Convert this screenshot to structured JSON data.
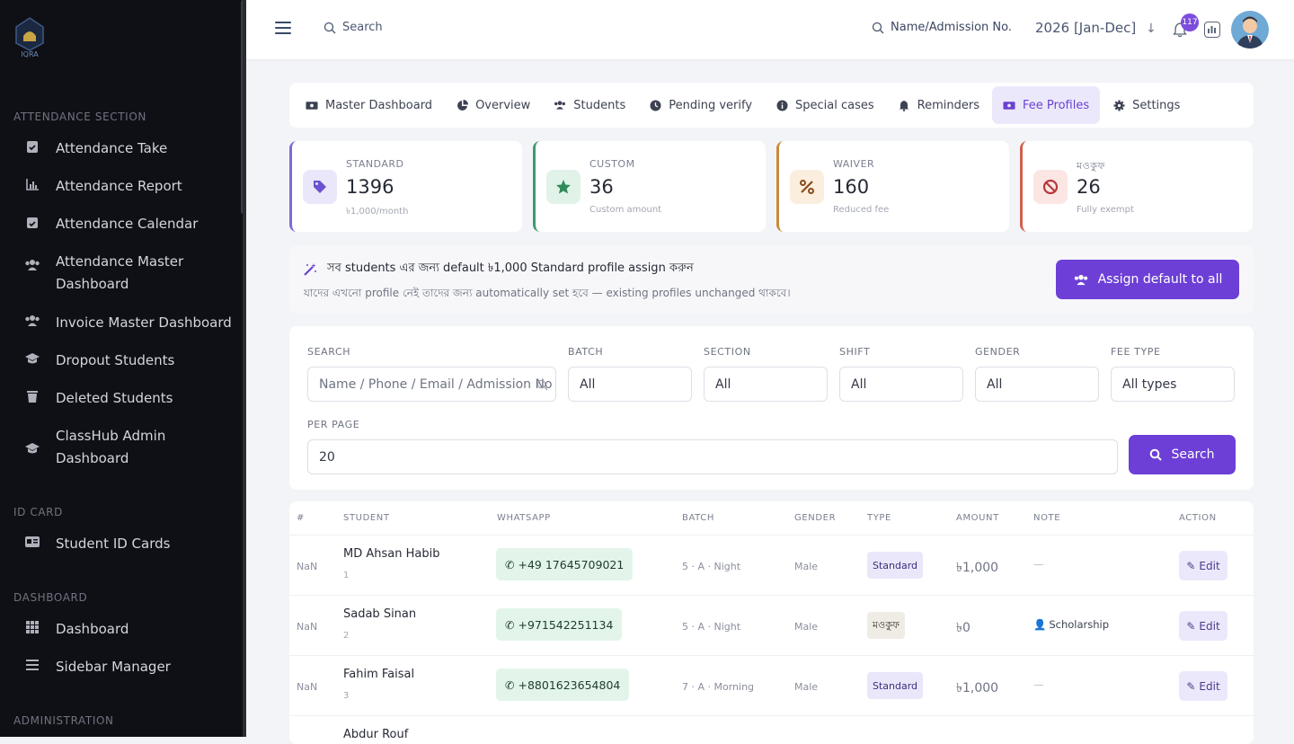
{
  "sidebar": {
    "logo_text": "IQRA",
    "sections": [
      {
        "title": "ATTENDANCE SECTION"
      },
      {
        "title": "ID CARD"
      },
      {
        "title": "DASHBOARD"
      },
      {
        "title": "ADMINISTRATION"
      }
    ],
    "items": [
      {
        "label": "Attendance Take",
        "icon": "clipboard-check-icon"
      },
      {
        "label": "Attendance Report",
        "icon": "bar-chart-icon"
      },
      {
        "label": "Attendance Calendar",
        "icon": "calendar-check-icon"
      },
      {
        "label": "Attendance Master Dashboard",
        "icon": "users-icon"
      },
      {
        "label": "Invoice Master Dashboard",
        "icon": "users-icon"
      },
      {
        "label": "Dropout Students",
        "icon": "graduation-cap-icon"
      },
      {
        "label": "Deleted Students",
        "icon": "trash-icon"
      },
      {
        "label": "ClassHub Admin Dashboard",
        "icon": "graduation-cap-icon"
      },
      {
        "label": "Student ID Cards",
        "icon": "id-card-icon"
      },
      {
        "label": "Dashboard",
        "icon": "grid-icon"
      },
      {
        "label": "Sidebar Manager",
        "icon": "list-icon"
      }
    ]
  },
  "topbar": {
    "search_label": "Search",
    "name_search_label": "Name/Admission No.",
    "year": "2026 [Jan-Dec]",
    "notification_count": "117"
  },
  "tabs": [
    {
      "label": "Master Dashboard",
      "icon": "money-icon"
    },
    {
      "label": "Overview",
      "icon": "pie-chart-icon"
    },
    {
      "label": "Students",
      "icon": "users-icon"
    },
    {
      "label": "Pending verify",
      "icon": "clock-icon"
    },
    {
      "label": "Special cases",
      "icon": "info-icon"
    },
    {
      "label": "Reminders",
      "icon": "bell-icon"
    },
    {
      "label": "Fee Profiles",
      "icon": "money-icon",
      "active": true
    },
    {
      "label": "Settings",
      "icon": "gear-icon"
    }
  ],
  "stats": [
    {
      "label": "STANDARD",
      "value": "1396",
      "sub": "৳1,000/month",
      "color": "#7a6ad8",
      "bg": "#ebe7fb",
      "icon": "tag-icon"
    },
    {
      "label": "CUSTOM",
      "value": "36",
      "sub": "Custom amount",
      "color": "#3f9a6a",
      "bg": "#e1f3e8",
      "icon": "star-icon"
    },
    {
      "label": "WAIVER",
      "value": "160",
      "sub": "Reduced fee",
      "color": "#c98a3a",
      "bg": "#fbeede",
      "icon": "percent-icon"
    },
    {
      "label": "মওকুফ",
      "value": "26",
      "sub": "Fully exempt",
      "color": "#d0604e",
      "bg": "#fbe6e3",
      "icon": "ban-icon"
    }
  ],
  "assign": {
    "title": "সব students এর জন্য default ৳1,000 Standard profile assign করুন",
    "subtitle": "যাদের এখনো profile নেই তাদের জন্য automatically set হবে — existing profiles unchanged থাকবে।",
    "button": "Assign default to all"
  },
  "filters": {
    "search_label": "SEARCH",
    "search_placeholder": "Name / Phone / Email / Admission No",
    "batch_label": "BATCH",
    "batch_value": "All",
    "section_label": "SECTION",
    "section_value": "All",
    "shift_label": "SHIFT",
    "shift_value": "All",
    "gender_label": "GENDER",
    "gender_value": "All",
    "feetype_label": "FEE TYPE",
    "feetype_value": "All types",
    "perpage_label": "PER PAGE",
    "perpage_value": "20",
    "search_button": "Search"
  },
  "table": {
    "headers": [
      "#",
      "STUDENT",
      "WHATSAPP",
      "BATCH",
      "GENDER",
      "TYPE",
      "AMOUNT",
      "NOTE",
      "ACTION"
    ],
    "rows": [
      {
        "idx": "NaN",
        "name": "MD Ahsan Habib",
        "sub": "1",
        "whatsapp": "+49 17645709021",
        "batch": "5 · A · Night",
        "gender": "Male",
        "type": "Standard",
        "amount": "৳1,000",
        "note": "—",
        "action": "Edit"
      },
      {
        "idx": "NaN",
        "name": "Sadab Sinan",
        "sub": "2",
        "whatsapp": "+971542251134",
        "batch": "5 · A · Night",
        "gender": "Male",
        "type": "মওকুফ",
        "amount": "৳0",
        "note": "Scholarship",
        "action": "Edit"
      },
      {
        "idx": "NaN",
        "name": "Fahim Faisal",
        "sub": "3",
        "whatsapp": "+8801623654804",
        "batch": "7 · A · Morning",
        "gender": "Male",
        "type": "Standard",
        "amount": "৳1,000",
        "note": "—",
        "action": "Edit"
      },
      {
        "idx": "",
        "name": "Abdur Rouf",
        "sub": "",
        "whatsapp": "",
        "batch": "",
        "gender": "",
        "type": "",
        "amount": "",
        "note": "",
        "action": ""
      }
    ]
  },
  "colors": {
    "accent": "#6d3fd6",
    "sidebar_bg": "#0f1015"
  }
}
